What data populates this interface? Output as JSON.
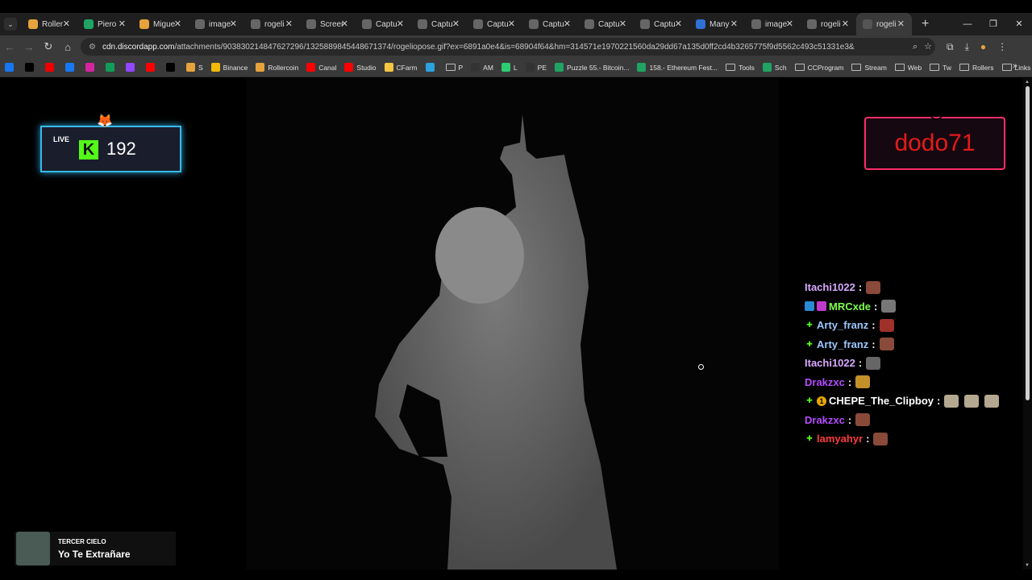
{
  "tabs": [
    {
      "title": "Roller",
      "icon": "hamster-icon",
      "color": "#e6a23c"
    },
    {
      "title": "Piero",
      "icon": "sheets-icon",
      "color": "#1fa463"
    },
    {
      "title": "Migue",
      "icon": "hamster-icon",
      "color": "#e6a23c"
    },
    {
      "title": "image",
      "icon": "globe-icon",
      "color": "#666"
    },
    {
      "title": "rogeli",
      "icon": "globe-icon",
      "color": "#666"
    },
    {
      "title": "Screen",
      "icon": "globe-icon",
      "color": "#666"
    },
    {
      "title": "Captu",
      "icon": "globe-icon",
      "color": "#666"
    },
    {
      "title": "Captu",
      "icon": "globe-icon",
      "color": "#666"
    },
    {
      "title": "Captu",
      "icon": "globe-icon",
      "color": "#666"
    },
    {
      "title": "Captu",
      "icon": "globe-icon",
      "color": "#666"
    },
    {
      "title": "Captu",
      "icon": "globe-icon",
      "color": "#666"
    },
    {
      "title": "Captu",
      "icon": "globe-icon",
      "color": "#666"
    },
    {
      "title": "Many",
      "icon": "gif-icon",
      "color": "#2f6fd6"
    },
    {
      "title": "image",
      "icon": "globe-icon",
      "color": "#666"
    },
    {
      "title": "rogeli",
      "icon": "globe-icon",
      "color": "#666"
    },
    {
      "title": "rogeli",
      "icon": "loading-icon",
      "color": "#555",
      "active": true
    }
  ],
  "url": {
    "host": "cdn.discordapp.com",
    "path": "/attachments/903830214847627296/1325889845448671374/rogeliopose.gif?ex=6891a0e4&is=68904f64&hm=314571e1970221560da29dd67a135d0ff2cd4b3265775f9d5562c493c51331e3&"
  },
  "bookmarks": [
    {
      "label": "",
      "color": "#1877f2"
    },
    {
      "label": "",
      "color": "#000"
    },
    {
      "label": "",
      "color": "#e00"
    },
    {
      "label": "",
      "color": "#1877f2"
    },
    {
      "label": "",
      "color": "#d6249f"
    },
    {
      "label": "",
      "color": "#0f9d58"
    },
    {
      "label": "",
      "color": "#9146ff"
    },
    {
      "label": "",
      "color": "#ff0000"
    },
    {
      "label": "",
      "color": "#000"
    },
    {
      "label": "S",
      "color": "#e6a23c"
    },
    {
      "label": "Binance",
      "color": "#f0b90b"
    },
    {
      "label": "Rollercoin",
      "color": "#e6a23c"
    },
    {
      "label": "Canal",
      "color": "#ff0000"
    },
    {
      "label": "Studio",
      "color": "#ff0000"
    },
    {
      "label": "CFarm",
      "color": "#f4c542"
    },
    {
      "label": "",
      "color": "#2aa3df"
    },
    {
      "label": "P",
      "folder": true
    },
    {
      "label": "AM",
      "color": "#333"
    },
    {
      "label": "L",
      "color": "#2ecc71"
    },
    {
      "label": "PE",
      "color": "#333"
    },
    {
      "label": "Puzzle 55.- Bitcoin...",
      "color": "#1fa463"
    },
    {
      "label": "158.- Ethereum Fest...",
      "color": "#1fa463"
    },
    {
      "label": "Tools",
      "folder": true
    },
    {
      "label": "Sch",
      "color": "#1fa463"
    },
    {
      "label": "CCProgram",
      "folder": true
    },
    {
      "label": "Stream",
      "folder": true
    },
    {
      "label": "Web",
      "folder": true
    },
    {
      "label": "Tw",
      "folder": true
    },
    {
      "label": "Rollers",
      "folder": true
    },
    {
      "label": "Links rc",
      "folder": true
    }
  ],
  "overlay": {
    "live_label": "LIVE",
    "kick_letter": "K",
    "viewer_count": "192",
    "top_donor": "dodo71"
  },
  "chat": [
    {
      "user": "Itachi1022",
      "color": "#d8a8ff",
      "badges": [],
      "emotes": [
        "#8a4a3a"
      ]
    },
    {
      "user": "MRCxde",
      "color": "#7cff4a",
      "badges": [
        {
          "c": "#2a8ad4"
        },
        {
          "c": "#c03acb"
        }
      ],
      "emotes": [
        "#777"
      ]
    },
    {
      "user": "Arty_franz",
      "color": "#9cc7ff",
      "badges": [
        {
          "c": "#53fc18",
          "g": "✚"
        }
      ],
      "emotes": [
        "#a0302a"
      ]
    },
    {
      "user": "Arty_franz",
      "color": "#9cc7ff",
      "badges": [
        {
          "c": "#53fc18",
          "g": "✚"
        }
      ],
      "emotes": [
        "#8a4a3a"
      ]
    },
    {
      "user": "Itachi1022",
      "color": "#d8a8ff",
      "badges": [],
      "emotes": [
        "#666"
      ]
    },
    {
      "user": "Drakzxc",
      "color": "#b44cff",
      "badges": [],
      "emotes": [
        "#c4902a"
      ]
    },
    {
      "user": "CHEPE_The_Clipboy",
      "color": "#ffffff",
      "badges": [
        {
          "c": "#53fc18",
          "g": "✚"
        },
        {
          "c": "#e6a800",
          "g": "1"
        }
      ],
      "emotes": [
        "#b4a890",
        "#b4a890",
        "#b4a890"
      ]
    },
    {
      "user": "Drakzxc",
      "color": "#b44cff",
      "badges": [],
      "emotes": [
        "#8a4a3a"
      ]
    },
    {
      "user": "lamyahyr",
      "color": "#ff3b3b",
      "badges": [
        {
          "c": "#53fc18",
          "g": "✚"
        }
      ],
      "emotes": [
        "#8a4a3a"
      ]
    }
  ],
  "music": {
    "artist": "TERCER CIELO",
    "song": "Yo Te Extrañare"
  }
}
